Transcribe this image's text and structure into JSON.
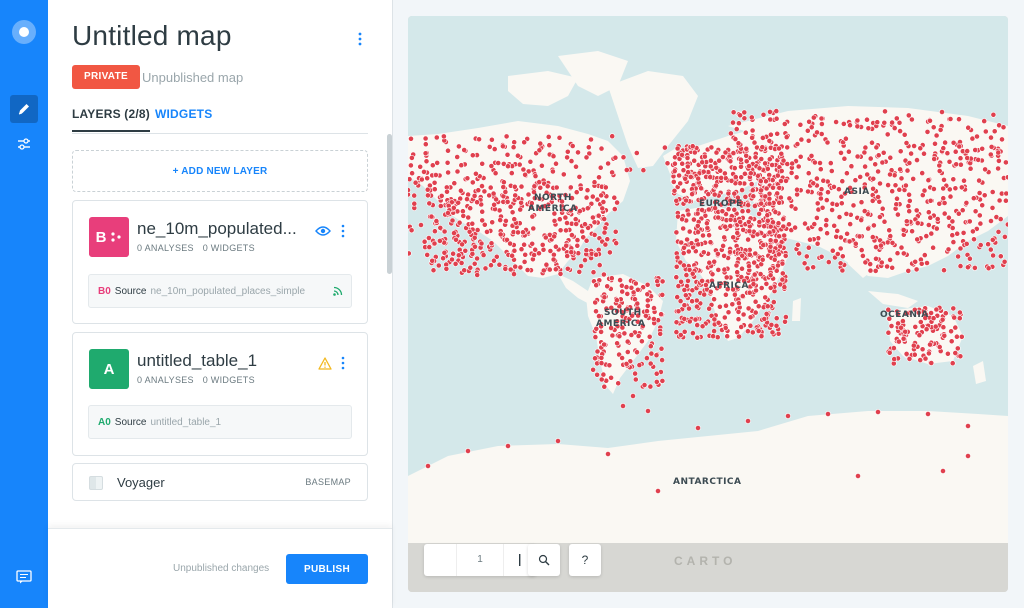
{
  "app": {
    "map_title": "Untitled map",
    "privacy": "PRIVATE",
    "publish_state": "Unpublished map"
  },
  "tabs": {
    "layers": "LAYERS (2/8)",
    "widgets": "WIDGETS"
  },
  "add_layer_label": "+ ADD NEW LAYER",
  "layers": [
    {
      "badge": "B",
      "color": "#e83e7b",
      "name": "ne_10m_populated...",
      "analyses": "0 ANALYSES",
      "widgets": "0 WIDGETS",
      "source_id": "B0",
      "source_label": "Source",
      "source_name": "ne_10m_populated_places_simple",
      "status_icon": "eye-icon"
    },
    {
      "badge": "A",
      "color": "#1faa6e",
      "name": "untitled_table_1",
      "analyses": "0 ANALYSES",
      "widgets": "0 WIDGETS",
      "source_id": "A0",
      "source_label": "Source",
      "source_name": "untitled_table_1",
      "status_icon": "warning-icon"
    }
  ],
  "basemap": {
    "name": "Voyager",
    "tag": "BASEMAP"
  },
  "footer": {
    "note": "Unpublished changes",
    "publish_label": "PUBLISH"
  },
  "map": {
    "continent_labels": [
      "NORTH",
      "AMERICA",
      "EUROPE",
      "ASIA",
      "AFRICA",
      "SOUTH",
      "AMERICA",
      "OCEANIA",
      "ANTARCTICA"
    ],
    "zoom_level": "1",
    "help_label": "?",
    "logo": "CARTO",
    "point_color": "#e0404e",
    "water_color": "#d4e8ea",
    "land_color": "#faf8f3"
  },
  "colors": {
    "accent": "#1785fb",
    "private": "#f15743"
  }
}
